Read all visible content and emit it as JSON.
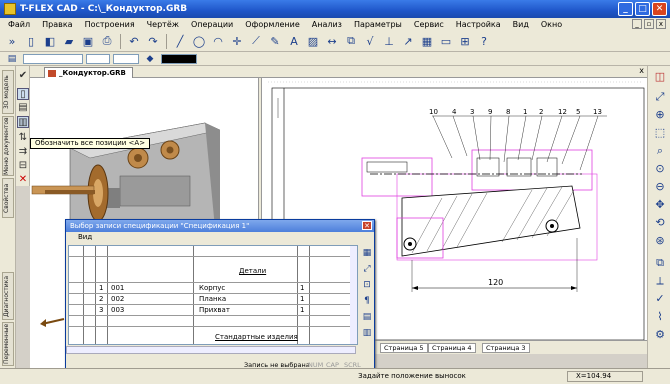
{
  "app": {
    "title": "T-FLEX CAD - C:\\_Кондуктор.GRB",
    "window_buttons": [
      "_",
      "□",
      "✕"
    ]
  },
  "menu": {
    "items": [
      "Файл",
      "Правка",
      "Построения",
      "Чертёж",
      "Операции",
      "Оформление",
      "Анализ",
      "Параметры",
      "Сервис",
      "Настройка",
      "Вид",
      "Окно"
    ]
  },
  "document": {
    "tab_label": "_Кондуктор.GRB"
  },
  "left_tabs": [
    "3D модель",
    "Меню документов",
    "Свойства",
    "Диагностика",
    "Переменные"
  ],
  "tooltip": "Обозначить все позиции <A>",
  "drawing": {
    "callouts": [
      "10",
      "4",
      "3",
      "9",
      "8",
      "1",
      "2",
      "12",
      "5",
      "13"
    ],
    "dimension": "120",
    "page_tabs": [
      "Страница 5",
      "Страница 4",
      "Страница 3"
    ]
  },
  "dialog": {
    "title": "Выбор записи спецификации \"Спецификация 1\"",
    "menu": "Вид",
    "section_details": "Детали",
    "rows": [
      {
        "pos": "1",
        "code": "001",
        "name": "Корпус",
        "qty": "1"
      },
      {
        "pos": "2",
        "code": "002",
        "name": "Планка",
        "qty": "1"
      },
      {
        "pos": "3",
        "code": "003",
        "name": "Прихват",
        "qty": "1"
      }
    ],
    "section_standard": "Стандартные изделия",
    "status": "Запись не выбрана",
    "indicators": [
      "NUM",
      "CAP",
      "SCRL"
    ]
  },
  "statusbar": {
    "message": "Задайте положение выносок",
    "coord": "X=104.94"
  },
  "colors": {
    "title_blue": "#1f56c9",
    "magenta_select": "#e040e0",
    "workspace": "#ece9d8"
  }
}
